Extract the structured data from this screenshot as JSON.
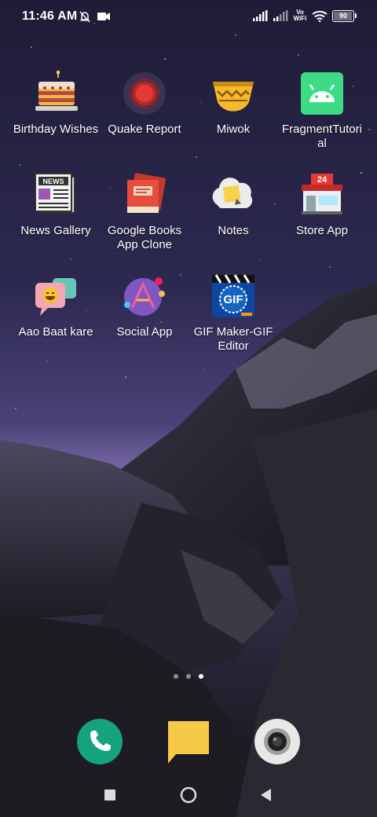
{
  "status_bar": {
    "time": "11:46 AM",
    "battery_level": "90",
    "network_label": "Vo WiFi",
    "icons": [
      "notifications-off-icon",
      "video-recording-icon",
      "signal-icon",
      "signal-secondary-icon",
      "volte-wifi-icon",
      "wifi-icon",
      "battery-icon"
    ]
  },
  "apps": [
    {
      "label": "Birthday Wishes",
      "icon": "birthday-cake-icon"
    },
    {
      "label": "Quake Report",
      "icon": "quake-report-icon"
    },
    {
      "label": "Miwok",
      "icon": "miwok-icon"
    },
    {
      "label": "FragmentTutorial",
      "icon": "android-icon"
    },
    {
      "label": "News Gallery",
      "icon": "newspaper-icon"
    },
    {
      "label": "Google Books App Clone",
      "icon": "book-icon"
    },
    {
      "label": "Notes",
      "icon": "notes-icon"
    },
    {
      "label": "Store App",
      "icon": "store-icon"
    },
    {
      "label": "Aao Baat kare",
      "icon": "chat-bubbles-icon"
    },
    {
      "label": "Social App",
      "icon": "social-app-icon"
    },
    {
      "label": "GIF Maker-GIF Editor",
      "icon": "gif-maker-icon"
    }
  ],
  "gif_icon_text": "GIF",
  "store_icon_text": "24",
  "news_icon_text": "NEWS",
  "page_indicator": {
    "count": 3,
    "active_index": 2
  },
  "dock": [
    {
      "icon": "phone-icon"
    },
    {
      "icon": "messages-icon"
    },
    {
      "icon": "camera-icon"
    }
  ],
  "nav": [
    {
      "icon": "recents-square-icon"
    },
    {
      "icon": "home-circle-icon"
    },
    {
      "icon": "back-triangle-icon"
    }
  ],
  "colors": {
    "sky_top": "#252242",
    "sky_bottom": "#6a5c9a",
    "phone_green": "#14a37f",
    "messages_yellow": "#f7c948"
  }
}
